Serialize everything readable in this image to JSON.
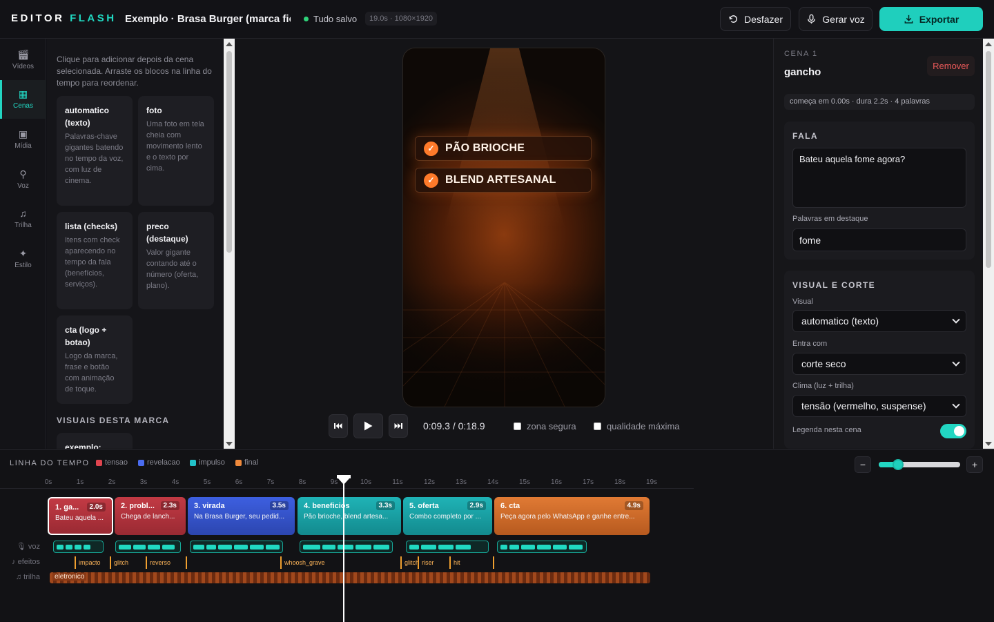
{
  "header": {
    "brand_primary": "EDITOR",
    "brand_accent": "FLASH",
    "project_title": "Exemplo · Brasa Burger (marca fictí",
    "save_status": "Tudo salvo",
    "meta": "19.0s · 1080×1920",
    "undo_label": "Desfazer",
    "voice_label": "Gerar voz",
    "export_label": "Exportar",
    "accent_color": "#1fcfbd"
  },
  "rail": {
    "items": [
      {
        "label": "Vídeos",
        "icon": "film-icon"
      },
      {
        "label": "Cenas",
        "icon": "grid-icon",
        "active": true
      },
      {
        "label": "Mídia",
        "icon": "image-icon"
      },
      {
        "label": "Voz",
        "icon": "mic-icon"
      },
      {
        "label": "Trilha",
        "icon": "music-icon"
      },
      {
        "label": "Estilo",
        "icon": "sparkle-icon"
      }
    ]
  },
  "library": {
    "hint": "Clique para adicionar depois da cena selecionada. Arraste os blocos na linha do tempo para reordenar.",
    "cards": [
      {
        "title": "automatico (texto)",
        "desc": "Palavras-chave gigantes batendo no tempo da voz, com luz de cinema."
      },
      {
        "title": "foto",
        "desc": "Uma foto em tela cheia com movimento lento e o texto por cima."
      },
      {
        "title": "lista (checks)",
        "desc": "Itens com check aparecendo no tempo da fala (benefícios, serviços)."
      },
      {
        "title": "preco (destaque)",
        "desc": "Valor gigante contando até o número (oferta, plano)."
      },
      {
        "title": "cta (logo + botao)",
        "desc": "Logo da marca, frase e botão com animação de toque."
      }
    ],
    "brand_section_title": "VISUAIS DESTA MARCA",
    "brand_peek": "exemplo:"
  },
  "preview": {
    "checks": [
      "PÃO BRIOCHE",
      "BLEND ARTESANAL"
    ],
    "timecode": "0:09.3 / 0:18.9",
    "safe_zone_label": "zona segura",
    "safe_zone_checked": false,
    "max_quality_label": "qualidade máxima",
    "max_quality_checked": false
  },
  "inspector": {
    "kicker": "CENA 1",
    "scene_name": "gancho",
    "remove_label": "Remover",
    "info": "começa em 0.00s · dura 2.2s · 4 palavras",
    "speech_group_title": "FALA",
    "speech_text": "Bateu aquela fome agora?",
    "highlight_label": "Palavras em destaque",
    "highlight_value": "fome",
    "visual_group_title": "VISUAL E CORTE",
    "visual_label": "Visual",
    "visual_value": "automatico (texto)",
    "enter_label": "Entra com",
    "enter_value": "corte seco",
    "mood_label": "Clima (luz + trilha)",
    "mood_value": "tensão (vermelho, suspense)",
    "caption_label": "Legenda nesta cena",
    "caption_on": true
  },
  "timeline": {
    "title": "LINHA DO TEMPO",
    "legend": [
      {
        "label": "tensao",
        "color": "#e0454f"
      },
      {
        "label": "revelacao",
        "color": "#4a6cf0"
      },
      {
        "label": "impulso",
        "color": "#22c2c9"
      },
      {
        "label": "final",
        "color": "#f08a3c"
      }
    ],
    "zoom_fraction": 0.24,
    "ruler": [
      "0s",
      "1s",
      "2s",
      "3s",
      "4s",
      "5s",
      "6s",
      "7s",
      "8s",
      "9s",
      "10s",
      "11s",
      "12s",
      "13s",
      "14s",
      "15s",
      "16s",
      "17s",
      "18s",
      "19s"
    ],
    "playhead_seconds": 9.3,
    "clips": [
      {
        "name": "1. ga...",
        "duration": "2.0s",
        "text": "Bateu aquela ...",
        "mood": "tensao",
        "selected": true
      },
      {
        "name": "2. probl...",
        "duration": "2.3s",
        "text": "Chega de lanch...",
        "mood": "tensao"
      },
      {
        "name": "3. virada",
        "duration": "3.5s",
        "text": "Na Brasa Burger, seu pedid...",
        "mood": "revelacao"
      },
      {
        "name": "4. beneficios",
        "duration": "3.3s",
        "text": "Pão brioche, blend artesa...",
        "mood": "impulso"
      },
      {
        "name": "5. oferta",
        "duration": "2.9s",
        "text": "Combo completo por ...",
        "mood": "impulso"
      },
      {
        "name": "6. cta",
        "duration": "4.9s",
        "text": "Peça agora pelo WhatsApp e ganhe entre...",
        "mood": "final"
      }
    ],
    "track_labels": {
      "voice": "voz",
      "effects": "efeitos",
      "music": "trilha"
    },
    "effects": [
      "impacto",
      "glitch",
      "reverso",
      "",
      "whoosh_grave",
      "glitch",
      "riser",
      "hit",
      ""
    ],
    "music_label": "eletronico"
  }
}
